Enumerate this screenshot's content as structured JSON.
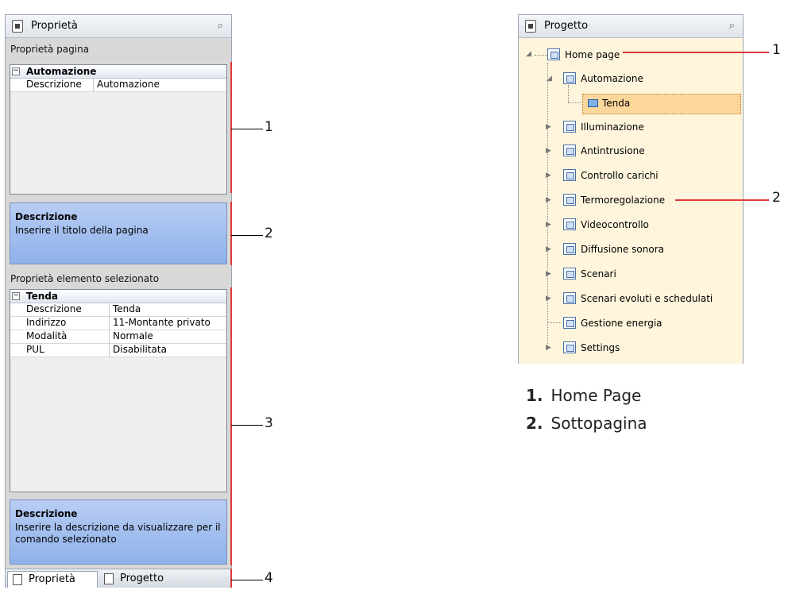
{
  "left_panel": {
    "title": "Proprietà",
    "page_props_label": "Proprietà pagina",
    "page_grid": {
      "category": "Automazione",
      "rows": [
        {
          "key": "Descrizione",
          "value": "Automazione"
        }
      ]
    },
    "page_desc": {
      "title": "Descrizione",
      "text": "Inserire il titolo della pagina"
    },
    "element_props_label": "Proprietà elemento selezionato",
    "element_grid": {
      "category": "Tenda",
      "rows": [
        {
          "key": "Descrizione",
          "value": "Tenda"
        },
        {
          "key": "Indirizzo",
          "value": "11-Montante privato"
        },
        {
          "key": "Modalità",
          "value": "Normale"
        },
        {
          "key": "PUL",
          "value": "Disabilitata"
        }
      ]
    },
    "element_desc": {
      "title": "Descrizione",
      "text": "Inserire la descrizione da visualizzare per il comando selezionato"
    },
    "tabs": [
      "Proprietà",
      "Progetto"
    ]
  },
  "left_callouts": [
    "1",
    "2",
    "3",
    "4"
  ],
  "right_panel": {
    "title": "Progetto",
    "tree": {
      "root": "Home page",
      "expanded": "Automazione",
      "selected_child": "Tenda",
      "pages": [
        "Illuminazione",
        "Antintrusione",
        "Controllo carichi",
        "Termoregolazione",
        "Videocontrollo",
        "Diffusione sonora",
        "Scenari",
        "Scenari evoluti e schedulati",
        "Gestione energia",
        "Settings"
      ]
    }
  },
  "right_callouts": [
    "1",
    "2"
  ],
  "legend": [
    {
      "num": "1.",
      "text": "Home Page"
    },
    {
      "num": "2.",
      "text": "Sottopagina"
    }
  ],
  "colors": {
    "callout_bar": "#e03a3a",
    "tree_bg": "#fff5dc",
    "selected_bg": "#fbd79b",
    "desc_bg": "#9fbbee"
  }
}
